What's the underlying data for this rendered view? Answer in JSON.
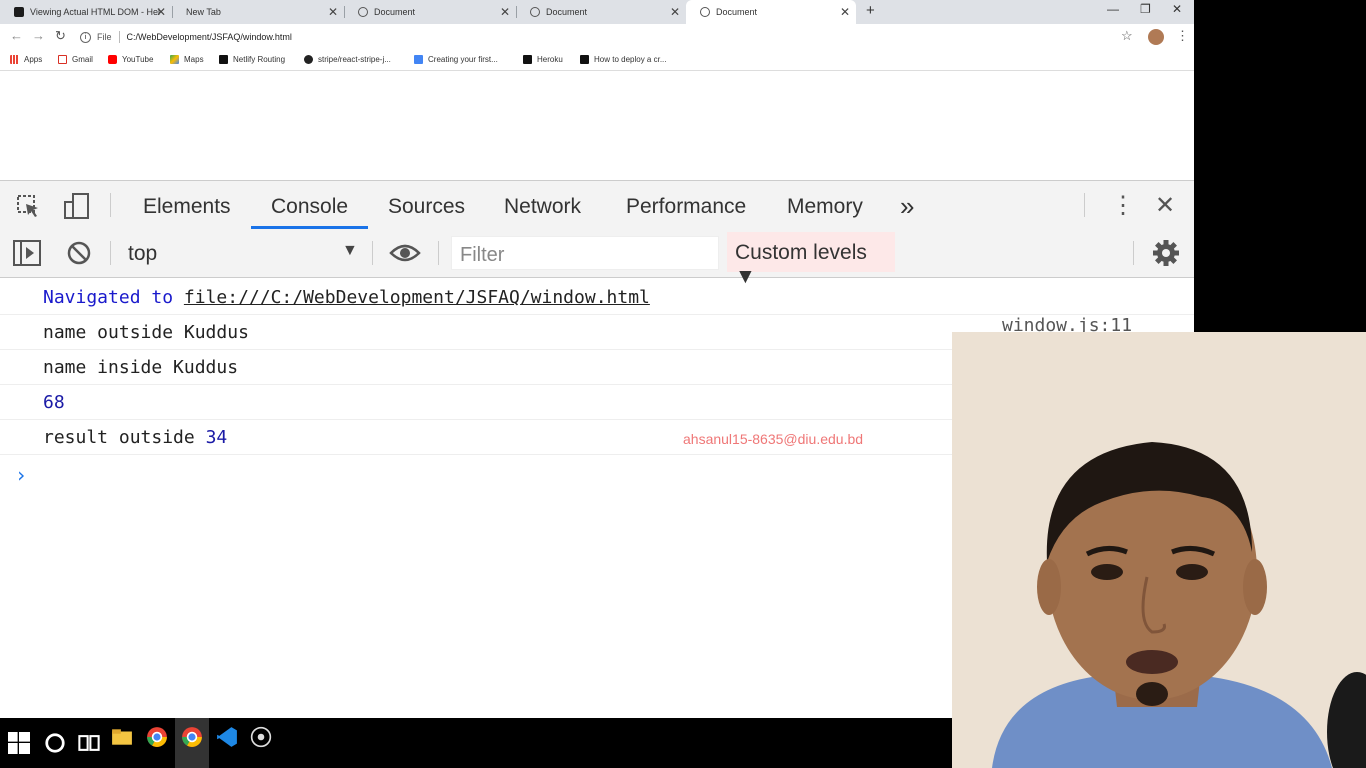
{
  "tabs": [
    {
      "label": "Viewing Actual HTML DOM - Hel"
    },
    {
      "label": "New Tab"
    },
    {
      "label": "Document"
    },
    {
      "label": "Document"
    },
    {
      "label": "Document"
    }
  ],
  "omnibox": {
    "scheme": "File",
    "url": "C:/WebDevelopment/JSFAQ/window.html"
  },
  "bookmarks": [
    {
      "label": "Apps"
    },
    {
      "label": "Gmail"
    },
    {
      "label": "YouTube"
    },
    {
      "label": "Maps"
    },
    {
      "label": "Netlify Routing"
    },
    {
      "label": "stripe/react-stripe-j..."
    },
    {
      "label": "Creating your first..."
    },
    {
      "label": "Heroku"
    },
    {
      "label": "How to deploy a cr..."
    }
  ],
  "devtools": {
    "tabs": [
      "Elements",
      "Console",
      "Sources",
      "Network",
      "Performance",
      "Memory"
    ],
    "more": "»",
    "context": "top",
    "filter_placeholder": "Filter",
    "levels": "Custom levels ▼"
  },
  "console": {
    "navigated_prefix": "Navigated to ",
    "navigated_url": "file:///C:/WebDevelopment/JSFAQ/window.html",
    "line1": "name outside Kuddus",
    "line1_src": "window.js:11",
    "line2": "name inside Kuddus",
    "line3": "68",
    "line4_text": "result outside ",
    "line4_num": "34",
    "prompt": "›"
  },
  "watermark": "ahsanul15-8635@diu.edu.bd",
  "colors": {
    "accent": "#1a73e8",
    "levels_bg": "#fde8e8",
    "watermark": "#ef7777"
  }
}
